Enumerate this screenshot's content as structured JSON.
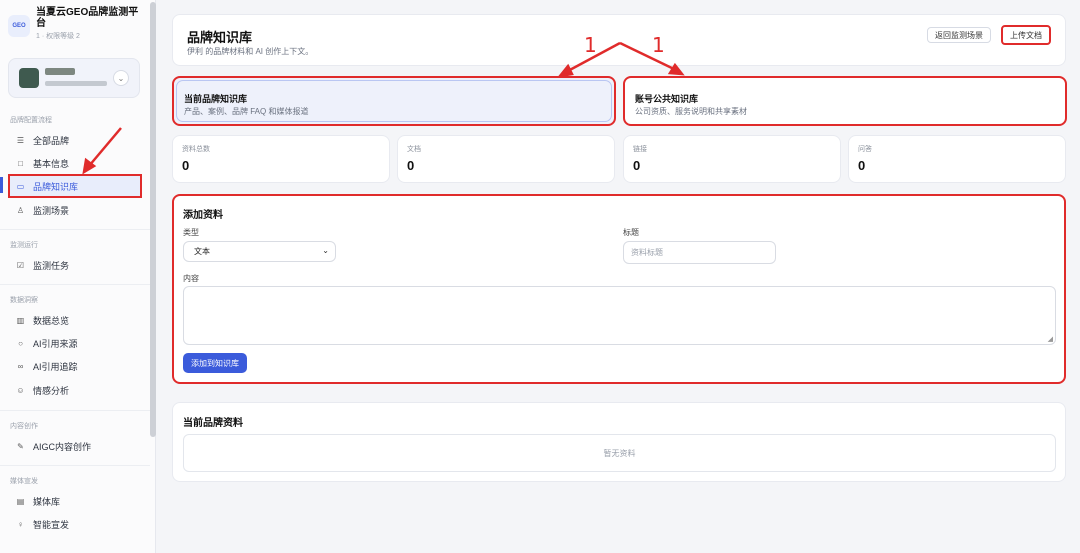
{
  "sidebar": {
    "logo_text": "GEO",
    "app_title": "当夏云GEO品牌监测平台",
    "app_sub": "1 · 权限等级 2",
    "account_toggle_icon": "chevron-down-icon",
    "sections": {
      "brand_flow": "品牌配置流程",
      "monitor_run": "监测运行",
      "data_insight": "数据洞察",
      "content_create": "内容创作",
      "media_publish": "媒体宣发"
    },
    "items": [
      {
        "label": "全部品牌",
        "icon": "☰"
      },
      {
        "label": "基本信息",
        "icon": "□"
      },
      {
        "label": "品牌知识库",
        "icon": "▭"
      },
      {
        "label": "监测场景",
        "icon": "♙"
      },
      {
        "label": "监测任务",
        "icon": "☑"
      },
      {
        "label": "数据总览",
        "icon": "▥"
      },
      {
        "label": "AI引用来源",
        "icon": "○"
      },
      {
        "label": "AI引用追踪",
        "icon": "∞"
      },
      {
        "label": "情感分析",
        "icon": "☺"
      },
      {
        "label": "AIGC内容创作",
        "icon": "✎"
      },
      {
        "label": "媒体库",
        "icon": "▤"
      },
      {
        "label": "智能宣发",
        "icon": "♀"
      }
    ]
  },
  "header": {
    "title": "品牌知识库",
    "subtitle": "伊利 的品牌材料和 AI 创作上下文。",
    "back_label": "返回监测场景",
    "upload_label": "上传文档"
  },
  "kb_tabs": {
    "current": {
      "title": "当前品牌知识库",
      "desc": "产品、案例、品牌 FAQ 和媒体报道"
    },
    "account": {
      "title": "账号公共知识库",
      "desc": "公司资质、服务说明和共享素材"
    }
  },
  "stats": [
    {
      "label": "资料总数",
      "value": "0"
    },
    {
      "label": "文档",
      "value": "0"
    },
    {
      "label": "链接",
      "value": "0"
    },
    {
      "label": "问答",
      "value": "0"
    }
  ],
  "add_form": {
    "title": "添加资料",
    "type_label": "类型",
    "type_value": "文本",
    "title_label": "标题",
    "title_placeholder": "资料标题",
    "content_label": "内容",
    "submit_label": "添加到知识库"
  },
  "list": {
    "title": "当前品牌资料",
    "empty": "暂无资料"
  },
  "annotations": {
    "left": "1",
    "right": "1"
  },
  "colors": {
    "accent": "#3b5bdb",
    "highlight": "#e02b2b"
  }
}
